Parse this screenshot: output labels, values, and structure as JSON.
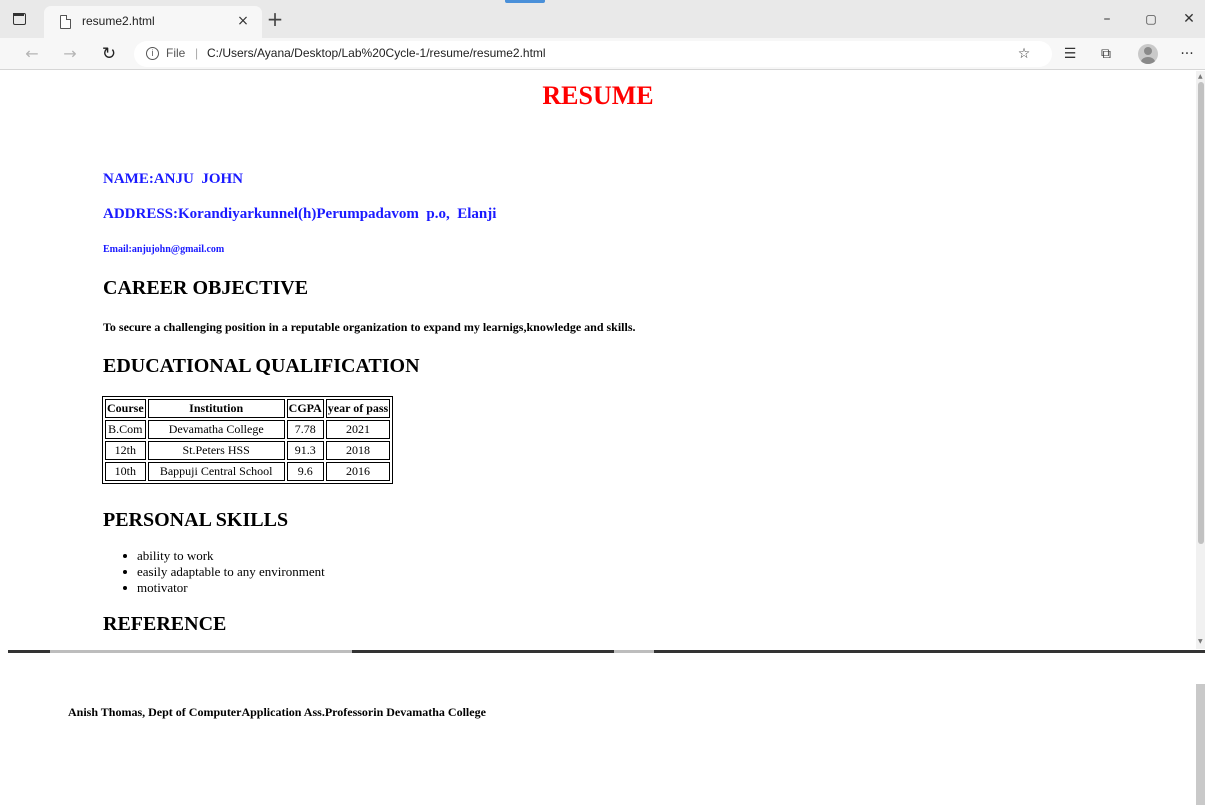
{
  "browser": {
    "tab_title": "resume2.html",
    "tab_close": "×",
    "new_tab": "+",
    "window_controls": {
      "minimize": "–",
      "restore": "▢",
      "close": "✕"
    },
    "address_label": "File",
    "address_separator": "|",
    "url": "C:/Users/Ayana/Desktop/Lab%20Cycle-1/resume/resume2.html",
    "icons": [
      "back-icon",
      "forward-icon",
      "refresh-icon",
      "info-icon",
      "favorite-add-icon",
      "favorites-icon",
      "collections-icon",
      "profile-icon",
      "more-icon"
    ]
  },
  "resume": {
    "title": "RESUME",
    "name": "NAME:ANJU  JOHN",
    "address": "ADDRESS:Korandiyarkunnel(h)Perumpadavom  p.o,  Elanji",
    "email": "Email:anjujohn@gmail.com",
    "career_heading": "CAREER OBJECTIVE",
    "career_objective": "To secure a challenging position in a reputable organization to expand my learnigs,knowledge and skills.",
    "education_heading": "EDUCATIONAL QUALIFICATION",
    "education_table": {
      "headers": [
        "Course",
        "Institution",
        "CGPA",
        "year of pass"
      ],
      "rows": [
        [
          "B.Com",
          "Devamatha College",
          "7.78",
          "2021"
        ],
        [
          "12th",
          "St.Peters HSS",
          "91.3",
          "2018"
        ],
        [
          "10th",
          "Bappuji Central School",
          "9.6",
          "2016"
        ]
      ]
    },
    "skills_heading": "PERSONAL SKILLS",
    "skills": [
      "ability to work",
      "easily adaptable to any environment",
      "motivator"
    ],
    "reference_heading": "REFERENCE",
    "reference_text": "Anish Thomas, Dept of ComputerApplication Ass.Professorin Devamatha College"
  }
}
